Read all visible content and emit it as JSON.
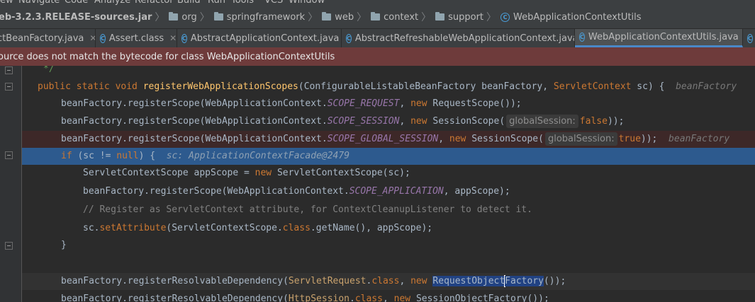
{
  "menu": [
    "ew",
    "Navigate",
    "Code",
    "Analyze",
    "Refactor",
    "Build",
    "Run",
    "Tools",
    "VCS",
    "Window"
  ],
  "breadcrumb": [
    "eb-3.2.3.RELEASE-sources.jar",
    "org",
    "springframework",
    "web",
    "context",
    "support",
    "WebApplicationContextUtils"
  ],
  "tabs": [
    "ctBeanFactory.java",
    "Assert.class",
    "AbstractApplicationContext.java",
    "AbstractRefreshableWebApplicationContext.java",
    "WebApplicationContextUtils.java"
  ],
  "warning": "ource does not match the bytecode for class WebApplicationContextUtils",
  "code": {
    "l0": "*/",
    "l1": {
      "kw": "public static void ",
      "fn": "registerWebApplicationScopes",
      "a": "(ConfigurableListableBeanFactory beanFactory, ",
      "b": "ServletContext",
      "c": " sc) {",
      "hint": "beanFactory"
    },
    "l2": {
      "a": "beanFactory.registerScope(WebApplicationContext.",
      "cst": "SCOPE_REQUEST",
      "b": ", ",
      "kw": "new ",
      "c": "RequestScope());"
    },
    "l3": {
      "a": "beanFactory.registerScope(WebApplicationContext.",
      "cst": "SCOPE_SESSION",
      "b": ", ",
      "kw": "new ",
      "c": "SessionScope(",
      "param": "globalSession:",
      "val": "false",
      "d": "));"
    },
    "l4": {
      "a": "beanFactory.registerScope(WebApplicationContext.",
      "cst": "SCOPE_GLOBAL_SESSION",
      "b": ", ",
      "kw": "new ",
      "c": "SessionScope(",
      "param": "globalSession:",
      "val": "true",
      "d": "));",
      "hint": "beanFactory"
    },
    "l5": {
      "kw": "if ",
      "a": "(sc != ",
      "kw2": "null",
      "b": ") {",
      "hint_name": "sc:",
      "hint_val": "ApplicationContextFacade@2479"
    },
    "l6": {
      "a": "ServletContextScope appScope = ",
      "kw": "new ",
      "b": "ServletContextScope(sc);"
    },
    "l7": {
      "a": "beanFactory.registerScope(WebApplicationContext.",
      "cst": "SCOPE_APPLICATION",
      "b": ", appScope);"
    },
    "l8": "// Register as ServletContext attribute, for ContextCleanupListener to detect it.",
    "l9": {
      "a": "sc.",
      "m": "setAttribute",
      "b": "(ServletContextScope.",
      "kw": "class",
      "c": ".getName(), appScope);"
    },
    "l10": "}",
    "l12": {
      "a": "beanFactory.registerResolvableDependency(",
      "cls": "ServletRequest",
      "b": ".",
      "kw": "class",
      "c": ", ",
      "kw2": "new ",
      "sel1": "RequestObject",
      "sel2": "Factory",
      "d": "());"
    },
    "l13": {
      "a": "beanFactory.registerResolvableDependency(",
      "cls": "HttpSession",
      "b": ".",
      "kw": "class",
      "c": ", ",
      "kw2": "new ",
      "d": "SessionObjectFactory());"
    }
  }
}
